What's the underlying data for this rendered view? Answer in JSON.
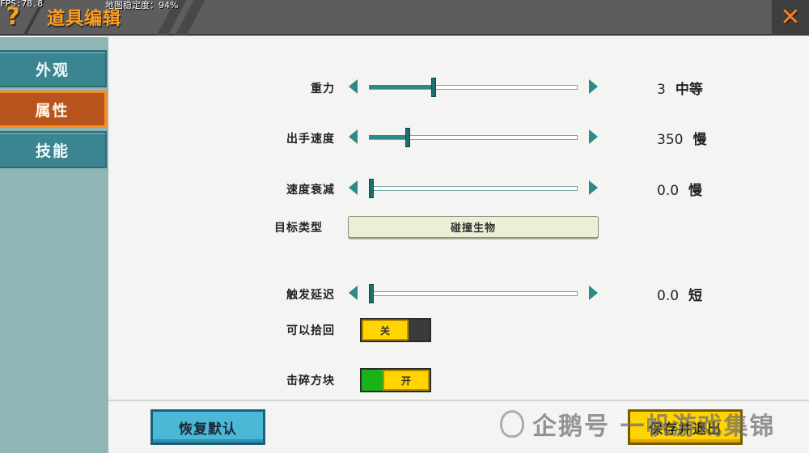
{
  "header": {
    "title": "道具编辑",
    "fps": "FPS:78.8",
    "stability": "地图稳定度：94%",
    "help_glyph": "?",
    "close_glyph": "✕"
  },
  "sidebar": {
    "tabs": [
      {
        "label": "外观",
        "active": false
      },
      {
        "label": "属性",
        "active": true
      },
      {
        "label": "技能",
        "active": false
      }
    ]
  },
  "sliders": [
    {
      "label": "重力",
      "value": "3",
      "word": "中等",
      "fill_fraction": 0.3
    },
    {
      "label": "出手速度",
      "value": "350",
      "word": "慢",
      "fill_fraction": 0.175
    },
    {
      "label": "速度衰减",
      "value": "0.0",
      "word": "慢",
      "fill_fraction": 0.0
    },
    {
      "label": "触发延迟",
      "value": "0.0",
      "word": "短",
      "fill_fraction": 0.0
    }
  ],
  "target_type": {
    "label": "目标类型",
    "value": "碰撞生物"
  },
  "toggles": [
    {
      "label": "可以拾回",
      "state": "关",
      "on": false
    },
    {
      "label": "击碎方块",
      "state": "开",
      "on": true
    }
  ],
  "footer": {
    "reset_label": "恢复默认",
    "save_label": "保存并退出"
  },
  "watermark": {
    "text": "企鹅号 一帆游戏集锦"
  },
  "colors": {
    "accent_teal": "#2d8a86",
    "tab_active": "#b8541d",
    "title_orange": "#ff9d1f",
    "toggle_on_green": "#19b319",
    "save_yellow": "#ffd400",
    "reset_blue": "#4cb8d8"
  },
  "icons": {
    "help": "question-mark-icon",
    "close": "close-x-icon",
    "decrease": "triangle-left-icon",
    "increase": "triangle-right-icon"
  }
}
